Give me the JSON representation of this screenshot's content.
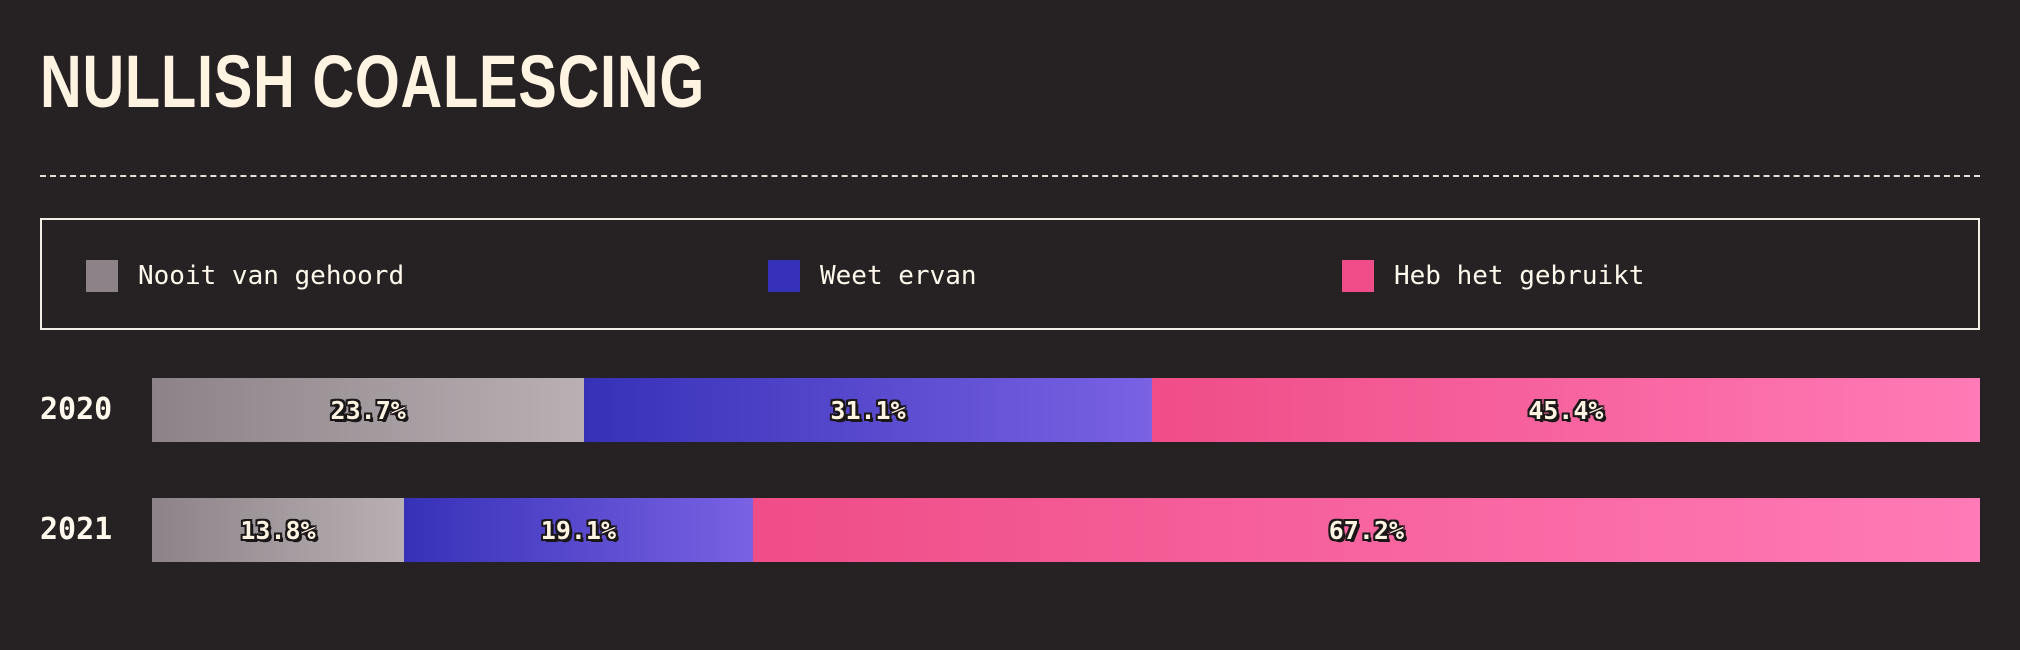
{
  "title": "NULLISH COALESCING",
  "colors": {
    "background": "#262224",
    "never_heard": [
      "#8b8387",
      "#b8b0b3"
    ],
    "know_about": [
      "#3631b8",
      "#7a62e3"
    ],
    "used": [
      "#ef4d87",
      "#ff7ab6"
    ]
  },
  "legend": [
    {
      "label": "Nooit van gehoord",
      "color": "#8b8387"
    },
    {
      "label": "Weet ervan",
      "color": "#3631b8"
    },
    {
      "label": "Heb het gebruikt",
      "color": "#ef4d87"
    }
  ],
  "chart_data": {
    "type": "bar",
    "orientation": "horizontal",
    "stacked": true,
    "normalized": true,
    "categories": [
      "2020",
      "2021"
    ],
    "series": [
      {
        "name": "Nooit van gehoord",
        "values": [
          23.7,
          13.8
        ],
        "labels": [
          "23.7%",
          "13.8%"
        ]
      },
      {
        "name": "Weet ervan",
        "values": [
          31.1,
          19.1
        ],
        "labels": [
          "31.1%",
          "19.1%"
        ]
      },
      {
        "name": "Heb het gebruikt",
        "values": [
          45.4,
          67.2
        ],
        "labels": [
          "45.4%",
          "67.2%"
        ]
      }
    ],
    "legend_position": "top",
    "grid": false
  }
}
